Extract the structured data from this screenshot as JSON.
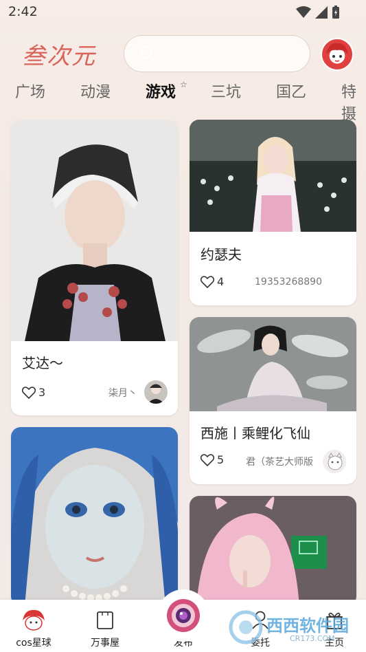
{
  "status_bar": {
    "time": "2:42"
  },
  "header": {
    "logo_text": "叁次元",
    "search": {
      "placeholder": ""
    }
  },
  "tabs": [
    {
      "label": "广场",
      "active": false
    },
    {
      "label": "动漫",
      "active": false
    },
    {
      "label": "游戏",
      "active": true
    },
    {
      "label": "三坑",
      "active": false
    },
    {
      "label": "国乙",
      "active": false
    },
    {
      "label": "特摄",
      "active": false
    }
  ],
  "cards": [
    {
      "title": "艾达～",
      "likes": "3",
      "author": "柒月丶"
    },
    {
      "title": "约瑟夫",
      "likes": "4",
      "author": "19353268890"
    },
    {
      "title": "西施丨乘鲤化飞仙",
      "likes": "5",
      "author": "君（茶艺大师版"
    },
    {
      "title": "",
      "likes": "",
      "author": ""
    },
    {
      "title": "",
      "likes": "",
      "author": ""
    }
  ],
  "bottom_nav": [
    {
      "label": "cos星球",
      "icon": "planet-mascot-icon"
    },
    {
      "label": "万事屋",
      "icon": "bag-icon"
    },
    {
      "label": "发布",
      "icon": "camera-lens-icon"
    },
    {
      "label": "委托",
      "icon": "person-icon"
    },
    {
      "label": "主页",
      "icon": "gift-icon"
    }
  ],
  "watermark": {
    "text": "西西软件园",
    "sub": "CR173.COM"
  },
  "colors": {
    "accent": "#d9645a",
    "background": "#f4e9e4"
  }
}
